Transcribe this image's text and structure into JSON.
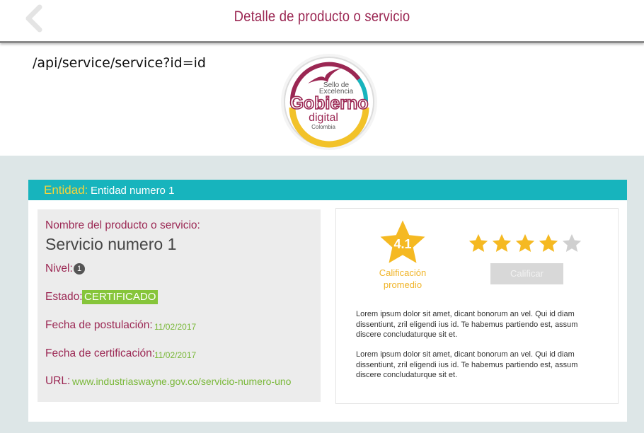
{
  "header": {
    "title": "Detalle de producto o servicio"
  },
  "api_path": "/api/service/service?id=id",
  "seal": {
    "line1": "Sello de",
    "line2": "Excelencia",
    "line3": "Gobierno",
    "line4": "digital",
    "line5": "Colombia"
  },
  "entity": {
    "label": "Entidad:",
    "value": "Entidad numero 1"
  },
  "details": {
    "name_label": "Nombre del producto o servicio:",
    "name_value": "Servicio numero 1",
    "level_label": "Nivel:",
    "level_value": "1",
    "status_label": "Estado:",
    "status_value": "CERTIFICADO",
    "application_date_label": "Fecha de postulación:",
    "application_date_value": "11/02/2017",
    "certification_date_label": "Fecha de certificación:",
    "certification_date_value": "11/02/2017",
    "url_label": "URL:",
    "url_value": "www.industriaswayne.gov.co/servicio-numero-uno"
  },
  "rating": {
    "average": "4.1",
    "caption_line1": "Calificación",
    "caption_line2": "promedio",
    "filled_stars": 4,
    "total_stars": 5,
    "rate_button": "Calificar"
  },
  "description": {
    "paragraph1": "Lorem ipsum dolor sit amet, dicant bonorum an vel. Qui id diam dissentiunt, zril eligendi ius id. Te habemus partiendo est, assum discere concludaturque sit et.",
    "paragraph2": "Lorem ipsum dolor sit amet, dicant bonorum an vel. Qui id diam dissentiunt, zril eligendi ius id. Te habemus partiendo est, assum discere concludaturque sit et."
  },
  "colors": {
    "brand_magenta": "#9b2753",
    "teal": "#17b4bd",
    "green": "#86c53a",
    "star_gold": "#f5b922",
    "star_empty": "#cfcfcf"
  }
}
